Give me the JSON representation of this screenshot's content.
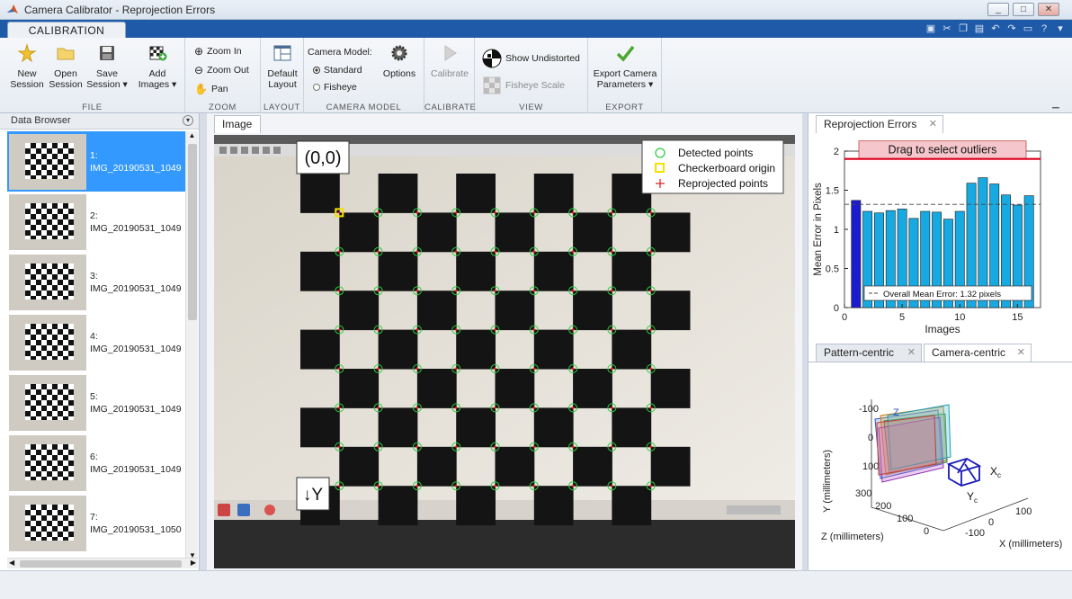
{
  "window": {
    "title": "Camera Calibrator - Reprojection Errors",
    "minimize": "_",
    "maximize": "□",
    "close": "✕"
  },
  "tabs": {
    "calibration": "CALIBRATION"
  },
  "ribbon": {
    "file": {
      "label": "FILE",
      "new_session": [
        "New",
        "Session"
      ],
      "open_session": [
        "Open",
        "Session"
      ],
      "save_session": [
        "Save",
        "Session ▾"
      ],
      "add_images": [
        "Add",
        "Images ▾"
      ]
    },
    "zoom": {
      "label": "ZOOM",
      "zoom_in": "Zoom In",
      "zoom_out": "Zoom Out",
      "pan": "Pan"
    },
    "layout": {
      "label": "LAYOUT",
      "default_layout": [
        "Default",
        "Layout"
      ]
    },
    "camera_model": {
      "label": "CAMERA MODEL",
      "title": "Camera Model:",
      "standard": "Standard",
      "fisheye": "Fisheye",
      "options": "Options"
    },
    "calibrate": {
      "label": "CALIBRATE",
      "calibrate": "Calibrate"
    },
    "view": {
      "label": "VIEW",
      "show_undistorted": "Show Undistorted",
      "fisheye_scale": "Fisheye Scale"
    },
    "export": {
      "label": "EXPORT",
      "export_camera": [
        "Export Camera",
        "Parameters ▾"
      ]
    }
  },
  "data_browser": {
    "title": "Data Browser",
    "items": [
      {
        "num": "1:",
        "name": "IMG_20190531_1049",
        "selected": true
      },
      {
        "num": "2:",
        "name": "IMG_20190531_1049",
        "selected": false
      },
      {
        "num": "3:",
        "name": "IMG_20190531_1049",
        "selected": false
      },
      {
        "num": "4:",
        "name": "IMG_20190531_1049",
        "selected": false
      },
      {
        "num": "5:",
        "name": "IMG_20190531_1049",
        "selected": false
      },
      {
        "num": "6:",
        "name": "IMG_20190531_1049",
        "selected": false
      },
      {
        "num": "7:",
        "name": "IMG_20190531_1050",
        "selected": false
      }
    ]
  },
  "image_panel": {
    "tab": "Image",
    "origin_label": "(0,0)",
    "y_label": "↓Y",
    "legend": {
      "detected": "Detected points",
      "origin": "Checkerboard origin",
      "reprojected": "Reprojected points"
    }
  },
  "reprojection_panel": {
    "tab": "Reprojection Errors",
    "close": "✕",
    "outlier_banner": "Drag to select outliers",
    "mean_label": "Overall Mean Error: 1.32 pixels",
    "chart_data": {
      "type": "bar",
      "x": [
        1,
        2,
        3,
        4,
        5,
        6,
        7,
        8,
        9,
        10,
        11,
        12,
        13,
        14,
        15,
        16
      ],
      "values": [
        1.37,
        1.23,
        1.21,
        1.24,
        1.26,
        1.14,
        1.23,
        1.22,
        1.13,
        1.23,
        1.59,
        1.66,
        1.58,
        1.44,
        1.31,
        1.43
      ],
      "selected_index": 0,
      "mean": 1.32,
      "xlabel": "Images",
      "ylabel": "Mean Error in Pixels",
      "ylim": [
        0,
        2
      ],
      "xlim": [
        0,
        17
      ],
      "xticks": [
        0,
        5,
        10,
        15
      ],
      "yticks": [
        0,
        0.5,
        1,
        1.5,
        2
      ],
      "threshold": 1.9,
      "colors": {
        "bar": "#17a9e1",
        "selected": "#1c1ccf",
        "threshold": "#d9001b",
        "banner": "#f5c6cb"
      }
    }
  },
  "extrinsics_panel": {
    "tab_pattern": "Pattern-centric",
    "tab_camera": "Camera-centric",
    "close": "✕",
    "y_label": "Y (millimeters)",
    "z_label": "Z (millimeters)",
    "x_label": "X (millimeters)",
    "y_ticks": [
      "-100",
      "0",
      "100"
    ],
    "z_ticks": [
      "300",
      "200",
      "100",
      "0"
    ],
    "x_ticks": [
      "100",
      "0",
      "-100"
    ],
    "axis_xc": "X",
    "axis_yc": "Y",
    "axis_sub": "c",
    "axis_z": "Z"
  }
}
